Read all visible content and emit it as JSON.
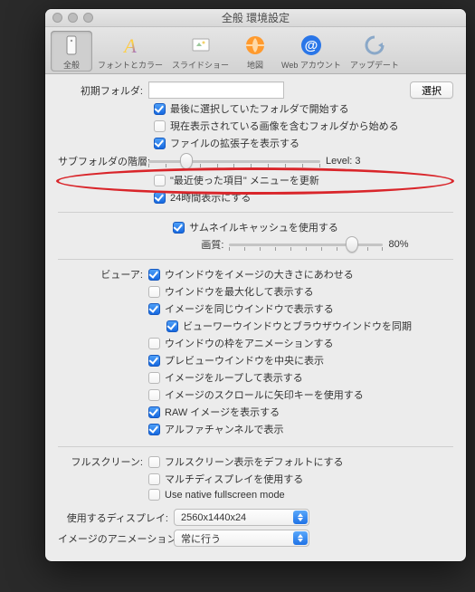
{
  "window": {
    "title": "全般 環境設定"
  },
  "toolbar": {
    "items": [
      {
        "label": "全般"
      },
      {
        "label": "フォントとカラー"
      },
      {
        "label": "スライドショー"
      },
      {
        "label": "地図"
      },
      {
        "label": "Web アカウント"
      },
      {
        "label": "アップデート"
      }
    ]
  },
  "initial_folder": {
    "label": "初期フォルダ:",
    "value": "",
    "button": "選択"
  },
  "checks_top": [
    {
      "checked": true,
      "label": "最後に選択していたフォルダで開始する"
    },
    {
      "checked": false,
      "label": "現在表示されている画像を含むフォルダから始める"
    },
    {
      "checked": true,
      "label": "ファイルの拡張子を表示する"
    }
  ],
  "subfolder": {
    "label": "サブフォルダの階層:",
    "value_text": "Level: 3",
    "position_pct": 22
  },
  "checks_mid": [
    {
      "checked": false,
      "label": "\"最近使った項目\" メニューを更新"
    },
    {
      "checked": true,
      "label": "24時間表示にする"
    }
  ],
  "thumb_cache": {
    "checked": true,
    "label": "サムネイルキャッシュを使用する"
  },
  "quality": {
    "label": "画質:",
    "value_text": "80%",
    "position_pct": 80
  },
  "viewer_label": "ビューア:",
  "viewer_checks": [
    {
      "checked": true,
      "label": "ウインドウをイメージの大きさにあわせる",
      "indent": 0
    },
    {
      "checked": false,
      "label": "ウインドウを最大化して表示する",
      "indent": 0
    },
    {
      "checked": true,
      "label": "イメージを同じウインドウで表示する",
      "indent": 0
    },
    {
      "checked": true,
      "label": "ビューワーウインドウとブラウザウインドウを同期",
      "indent": 1
    },
    {
      "checked": false,
      "label": "ウインドウの枠をアニメーションする",
      "indent": 0
    },
    {
      "checked": true,
      "label": "プレビューウインドウを中央に表示",
      "indent": 0
    },
    {
      "checked": false,
      "label": "イメージをループして表示する",
      "indent": 0
    },
    {
      "checked": false,
      "label": "イメージのスクロールに矢印キーを使用する",
      "indent": 0
    },
    {
      "checked": true,
      "label": "RAW イメージを表示する",
      "indent": 0
    },
    {
      "checked": true,
      "label": "アルファチャンネルで表示",
      "indent": 0
    }
  ],
  "fullscreen_label": "フルスクリーン:",
  "fullscreen_checks": [
    {
      "checked": false,
      "label": "フルスクリーン表示をデフォルトにする"
    },
    {
      "checked": false,
      "label": "マルチディスプレイを使用する"
    },
    {
      "checked": false,
      "label": "Use native fullscreen mode"
    }
  ],
  "display": {
    "label": "使用するディスプレイ:",
    "value": "2560x1440x24"
  },
  "animation": {
    "label": "イメージのアニメーション:",
    "value": "常に行う"
  }
}
